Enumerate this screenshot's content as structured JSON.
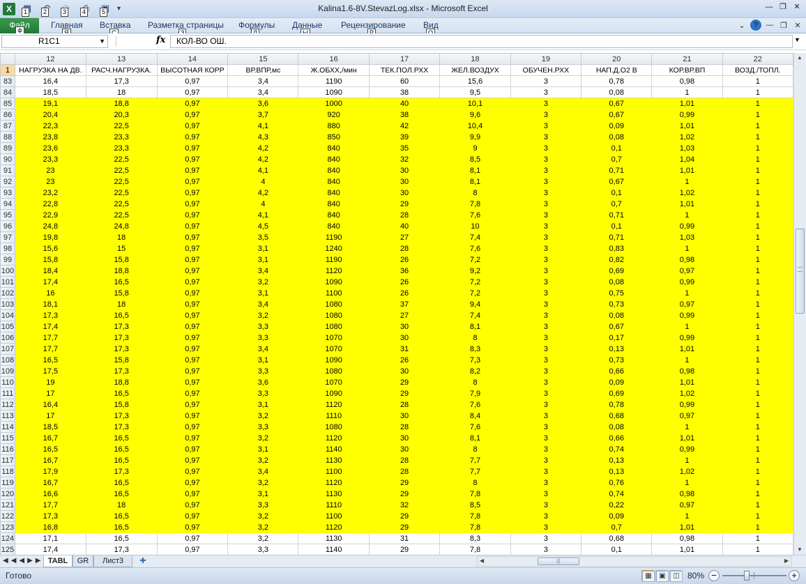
{
  "title_bar": {
    "title": "Kalina1.6-8V.StevazLog.xlsx - Microsoft Excel",
    "app_icon": "X",
    "qat_keytips": [
      "1",
      "2",
      "3",
      "4",
      "5"
    ],
    "qat_icons": [
      "save-icon",
      "undo-icon",
      "redo-icon",
      "quick-print-icon",
      "print-preview-icon"
    ]
  },
  "ribbon": {
    "file": {
      "label": "Файл",
      "keytip": "Ф"
    },
    "tabs": [
      {
        "label": "Главная",
        "keytip": "Я"
      },
      {
        "label": "Вставка",
        "keytip": "С"
      },
      {
        "label": "Разметка страницы",
        "keytip": "З"
      },
      {
        "label": "Формулы",
        "keytip": "Л"
      },
      {
        "label": "Данные",
        "keytip": "Ы"
      },
      {
        "label": "Рецензирование",
        "keytip": "Р"
      },
      {
        "label": "Вид",
        "keytip": "О"
      }
    ]
  },
  "formula_bar": {
    "name_box": "R1C1",
    "fx": "fx",
    "content": "КОЛ-ВО ОШ."
  },
  "grid": {
    "column_numbers": [
      "12",
      "13",
      "14",
      "15",
      "16",
      "17",
      "18",
      "19",
      "20",
      "21",
      "22"
    ],
    "header_row_number": "1",
    "headers": [
      "НАГРУЗКА НА ДВ.",
      "РАСЧ.НАГРУЗКА.",
      "ВЫСОТНАЯ КОРР",
      "ВР.ВПР,мс",
      "Ж.ОБХХ,/мин",
      "ТЕК.ПОЛ.РХХ",
      "ЖЕЛ.ВОЗДУХ",
      "ОБУЧЕН.РХХ",
      "НАП.Д.О2 В",
      "КОР.ВР.ВП",
      "ВОЗД./ТОПЛ."
    ],
    "rows": [
      {
        "n": "83",
        "hl": false,
        "c": [
          "16,4",
          "17,3",
          "0,97",
          "3,4",
          "1190",
          "60",
          "15,6",
          "3",
          "0,78",
          "0,98",
          "1"
        ]
      },
      {
        "n": "84",
        "hl": false,
        "c": [
          "18,5",
          "18",
          "0,97",
          "3,4",
          "1090",
          "38",
          "9,5",
          "3",
          "0,08",
          "1",
          "1"
        ]
      },
      {
        "n": "85",
        "hl": true,
        "c": [
          "19,1",
          "18,8",
          "0,97",
          "3,6",
          "1000",
          "40",
          "10,1",
          "3",
          "0,67",
          "1,01",
          "1"
        ]
      },
      {
        "n": "86",
        "hl": true,
        "c": [
          "20,4",
          "20,3",
          "0,97",
          "3,7",
          "920",
          "38",
          "9,6",
          "3",
          "0,67",
          "0,99",
          "1"
        ]
      },
      {
        "n": "87",
        "hl": true,
        "c": [
          "22,3",
          "22,5",
          "0,97",
          "4,1",
          "880",
          "42",
          "10,4",
          "3",
          "0,09",
          "1,01",
          "1"
        ]
      },
      {
        "n": "88",
        "hl": true,
        "c": [
          "23,8",
          "23,3",
          "0,97",
          "4,3",
          "850",
          "39",
          "9,9",
          "3",
          "0,08",
          "1,02",
          "1"
        ]
      },
      {
        "n": "89",
        "hl": true,
        "c": [
          "23,6",
          "23,3",
          "0,97",
          "4,2",
          "840",
          "35",
          "9",
          "3",
          "0,1",
          "1,03",
          "1"
        ]
      },
      {
        "n": "90",
        "hl": true,
        "c": [
          "23,3",
          "22,5",
          "0,97",
          "4,2",
          "840",
          "32",
          "8,5",
          "3",
          "0,7",
          "1,04",
          "1"
        ]
      },
      {
        "n": "91",
        "hl": true,
        "c": [
          "23",
          "22,5",
          "0,97",
          "4,1",
          "840",
          "30",
          "8,1",
          "3",
          "0,71",
          "1,01",
          "1"
        ]
      },
      {
        "n": "92",
        "hl": true,
        "c": [
          "23",
          "22,5",
          "0,97",
          "4",
          "840",
          "30",
          "8,1",
          "3",
          "0,67",
          "1",
          "1"
        ]
      },
      {
        "n": "93",
        "hl": true,
        "c": [
          "23,2",
          "22,5",
          "0,97",
          "4,2",
          "840",
          "30",
          "8",
          "3",
          "0,1",
          "1,02",
          "1"
        ]
      },
      {
        "n": "94",
        "hl": true,
        "c": [
          "22,8",
          "22,5",
          "0,97",
          "4",
          "840",
          "29",
          "7,8",
          "3",
          "0,7",
          "1,01",
          "1"
        ]
      },
      {
        "n": "95",
        "hl": true,
        "c": [
          "22,9",
          "22,5",
          "0,97",
          "4,1",
          "840",
          "28",
          "7,6",
          "3",
          "0,71",
          "1",
          "1"
        ]
      },
      {
        "n": "96",
        "hl": true,
        "c": [
          "24,8",
          "24,8",
          "0,97",
          "4,5",
          "840",
          "40",
          "10",
          "3",
          "0,1",
          "0,99",
          "1"
        ]
      },
      {
        "n": "97",
        "hl": true,
        "c": [
          "19,8",
          "18",
          "0,97",
          "3,5",
          "1190",
          "27",
          "7,4",
          "3",
          "0,71",
          "1,03",
          "1"
        ]
      },
      {
        "n": "98",
        "hl": true,
        "c": [
          "15,6",
          "15",
          "0,97",
          "3,1",
          "1240",
          "28",
          "7,6",
          "3",
          "0,83",
          "1",
          "1"
        ]
      },
      {
        "n": "99",
        "hl": true,
        "c": [
          "15,8",
          "15,8",
          "0,97",
          "3,1",
          "1190",
          "26",
          "7,2",
          "3",
          "0,82",
          "0,98",
          "1"
        ]
      },
      {
        "n": "100",
        "hl": true,
        "c": [
          "18,4",
          "18,8",
          "0,97",
          "3,4",
          "1120",
          "36",
          "9,2",
          "3",
          "0,69",
          "0,97",
          "1"
        ]
      },
      {
        "n": "101",
        "hl": true,
        "c": [
          "17,4",
          "16,5",
          "0,97",
          "3,2",
          "1090",
          "26",
          "7,2",
          "3",
          "0,08",
          "0,99",
          "1"
        ]
      },
      {
        "n": "102",
        "hl": true,
        "c": [
          "16",
          "15,8",
          "0,97",
          "3,1",
          "1100",
          "26",
          "7,2",
          "3",
          "0,75",
          "1",
          "1"
        ]
      },
      {
        "n": "103",
        "hl": true,
        "c": [
          "18,1",
          "18",
          "0,97",
          "3,4",
          "1080",
          "37",
          "9,4",
          "3",
          "0,73",
          "0,97",
          "1"
        ]
      },
      {
        "n": "104",
        "hl": true,
        "c": [
          "17,3",
          "16,5",
          "0,97",
          "3,2",
          "1080",
          "27",
          "7,4",
          "3",
          "0,08",
          "0,99",
          "1"
        ]
      },
      {
        "n": "105",
        "hl": true,
        "c": [
          "17,4",
          "17,3",
          "0,97",
          "3,3",
          "1080",
          "30",
          "8,1",
          "3",
          "0,67",
          "1",
          "1"
        ]
      },
      {
        "n": "106",
        "hl": true,
        "c": [
          "17,7",
          "17,3",
          "0,97",
          "3,3",
          "1070",
          "30",
          "8",
          "3",
          "0,17",
          "0,99",
          "1"
        ]
      },
      {
        "n": "107",
        "hl": true,
        "c": [
          "17,7",
          "17,3",
          "0,97",
          "3,4",
          "1070",
          "31",
          "8,3",
          "3",
          "0,13",
          "1,01",
          "1"
        ]
      },
      {
        "n": "108",
        "hl": true,
        "c": [
          "16,5",
          "15,8",
          "0,97",
          "3,1",
          "1090",
          "26",
          "7,3",
          "3",
          "0,73",
          "1",
          "1"
        ]
      },
      {
        "n": "109",
        "hl": true,
        "c": [
          "17,5",
          "17,3",
          "0,97",
          "3,3",
          "1080",
          "30",
          "8,2",
          "3",
          "0,66",
          "0,98",
          "1"
        ]
      },
      {
        "n": "110",
        "hl": true,
        "c": [
          "19",
          "18,8",
          "0,97",
          "3,6",
          "1070",
          "29",
          "8",
          "3",
          "0,09",
          "1,01",
          "1"
        ]
      },
      {
        "n": "111",
        "hl": true,
        "c": [
          "17",
          "16,5",
          "0,97",
          "3,3",
          "1090",
          "29",
          "7,9",
          "3",
          "0,69",
          "1,02",
          "1"
        ]
      },
      {
        "n": "112",
        "hl": true,
        "c": [
          "16,4",
          "15,8",
          "0,97",
          "3,1",
          "1120",
          "28",
          "7,6",
          "3",
          "0,78",
          "0,99",
          "1"
        ]
      },
      {
        "n": "113",
        "hl": true,
        "c": [
          "17",
          "17,3",
          "0,97",
          "3,2",
          "1110",
          "30",
          "8,4",
          "3",
          "0,68",
          "0,97",
          "1"
        ]
      },
      {
        "n": "114",
        "hl": true,
        "c": [
          "18,5",
          "17,3",
          "0,97",
          "3,3",
          "1080",
          "28",
          "7,6",
          "3",
          "0,08",
          "1",
          "1"
        ]
      },
      {
        "n": "115",
        "hl": true,
        "c": [
          "16,7",
          "16,5",
          "0,97",
          "3,2",
          "1120",
          "30",
          "8,1",
          "3",
          "0,66",
          "1,01",
          "1"
        ]
      },
      {
        "n": "116",
        "hl": true,
        "c": [
          "16,5",
          "16,5",
          "0,97",
          "3,1",
          "1140",
          "30",
          "8",
          "3",
          "0,74",
          "0,99",
          "1"
        ]
      },
      {
        "n": "117",
        "hl": true,
        "c": [
          "16,7",
          "16,5",
          "0,97",
          "3,2",
          "1130",
          "28",
          "7,7",
          "3",
          "0,13",
          "1",
          "1"
        ]
      },
      {
        "n": "118",
        "hl": true,
        "c": [
          "17,9",
          "17,3",
          "0,97",
          "3,4",
          "1100",
          "28",
          "7,7",
          "3",
          "0,13",
          "1,02",
          "1"
        ]
      },
      {
        "n": "119",
        "hl": true,
        "c": [
          "16,7",
          "16,5",
          "0,97",
          "3,2",
          "1120",
          "29",
          "8",
          "3",
          "0,76",
          "1",
          "1"
        ]
      },
      {
        "n": "120",
        "hl": true,
        "c": [
          "16,6",
          "16,5",
          "0,97",
          "3,1",
          "1130",
          "29",
          "7,8",
          "3",
          "0,74",
          "0,98",
          "1"
        ]
      },
      {
        "n": "121",
        "hl": true,
        "c": [
          "17,7",
          "18",
          "0,97",
          "3,3",
          "1110",
          "32",
          "8,5",
          "3",
          "0,22",
          "0,97",
          "1"
        ]
      },
      {
        "n": "122",
        "hl": true,
        "c": [
          "17,3",
          "16,5",
          "0,97",
          "3,2",
          "1100",
          "29",
          "7,8",
          "3",
          "0,09",
          "1",
          "1"
        ]
      },
      {
        "n": "123",
        "hl": true,
        "c": [
          "16,8",
          "16,5",
          "0,97",
          "3,2",
          "1120",
          "29",
          "7,8",
          "3",
          "0,7",
          "1,01",
          "1"
        ]
      },
      {
        "n": "124",
        "hl": false,
        "c": [
          "17,1",
          "16,5",
          "0,97",
          "3,2",
          "1130",
          "31",
          "8,3",
          "3",
          "0,68",
          "0,98",
          "1"
        ]
      },
      {
        "n": "125",
        "hl": false,
        "c": [
          "17,4",
          "17,3",
          "0,97",
          "3,3",
          "1140",
          "29",
          "7,8",
          "3",
          "0,1",
          "1,01",
          "1"
        ]
      }
    ],
    "highlight_color": "#ffff00"
  },
  "sheets": {
    "tabs": [
      {
        "label": "TABL",
        "active": true
      },
      {
        "label": "GR",
        "active": false
      },
      {
        "label": "Лист3",
        "active": false
      }
    ]
  },
  "status_bar": {
    "status": "Готово",
    "zoom": "80%",
    "zoom_level": 80
  }
}
